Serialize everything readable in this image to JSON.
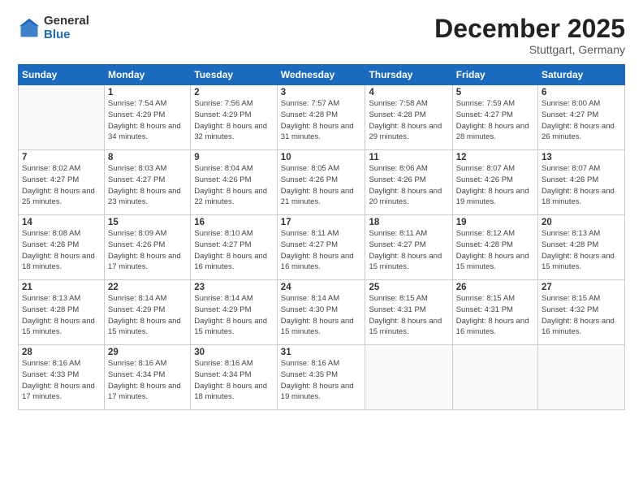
{
  "logo": {
    "general": "General",
    "blue": "Blue"
  },
  "header": {
    "month": "December 2025",
    "location": "Stuttgart, Germany"
  },
  "weekdays": [
    "Sunday",
    "Monday",
    "Tuesday",
    "Wednesday",
    "Thursday",
    "Friday",
    "Saturday"
  ],
  "weeks": [
    [
      {
        "day": "",
        "sunrise": "",
        "sunset": "",
        "daylight": ""
      },
      {
        "day": "1",
        "sunrise": "Sunrise: 7:54 AM",
        "sunset": "Sunset: 4:29 PM",
        "daylight": "Daylight: 8 hours and 34 minutes."
      },
      {
        "day": "2",
        "sunrise": "Sunrise: 7:56 AM",
        "sunset": "Sunset: 4:29 PM",
        "daylight": "Daylight: 8 hours and 32 minutes."
      },
      {
        "day": "3",
        "sunrise": "Sunrise: 7:57 AM",
        "sunset": "Sunset: 4:28 PM",
        "daylight": "Daylight: 8 hours and 31 minutes."
      },
      {
        "day": "4",
        "sunrise": "Sunrise: 7:58 AM",
        "sunset": "Sunset: 4:28 PM",
        "daylight": "Daylight: 8 hours and 29 minutes."
      },
      {
        "day": "5",
        "sunrise": "Sunrise: 7:59 AM",
        "sunset": "Sunset: 4:27 PM",
        "daylight": "Daylight: 8 hours and 28 minutes."
      },
      {
        "day": "6",
        "sunrise": "Sunrise: 8:00 AM",
        "sunset": "Sunset: 4:27 PM",
        "daylight": "Daylight: 8 hours and 26 minutes."
      }
    ],
    [
      {
        "day": "7",
        "sunrise": "Sunrise: 8:02 AM",
        "sunset": "Sunset: 4:27 PM",
        "daylight": "Daylight: 8 hours and 25 minutes."
      },
      {
        "day": "8",
        "sunrise": "Sunrise: 8:03 AM",
        "sunset": "Sunset: 4:27 PM",
        "daylight": "Daylight: 8 hours and 23 minutes."
      },
      {
        "day": "9",
        "sunrise": "Sunrise: 8:04 AM",
        "sunset": "Sunset: 4:26 PM",
        "daylight": "Daylight: 8 hours and 22 minutes."
      },
      {
        "day": "10",
        "sunrise": "Sunrise: 8:05 AM",
        "sunset": "Sunset: 4:26 PM",
        "daylight": "Daylight: 8 hours and 21 minutes."
      },
      {
        "day": "11",
        "sunrise": "Sunrise: 8:06 AM",
        "sunset": "Sunset: 4:26 PM",
        "daylight": "Daylight: 8 hours and 20 minutes."
      },
      {
        "day": "12",
        "sunrise": "Sunrise: 8:07 AM",
        "sunset": "Sunset: 4:26 PM",
        "daylight": "Daylight: 8 hours and 19 minutes."
      },
      {
        "day": "13",
        "sunrise": "Sunrise: 8:07 AM",
        "sunset": "Sunset: 4:26 PM",
        "daylight": "Daylight: 8 hours and 18 minutes."
      }
    ],
    [
      {
        "day": "14",
        "sunrise": "Sunrise: 8:08 AM",
        "sunset": "Sunset: 4:26 PM",
        "daylight": "Daylight: 8 hours and 18 minutes."
      },
      {
        "day": "15",
        "sunrise": "Sunrise: 8:09 AM",
        "sunset": "Sunset: 4:26 PM",
        "daylight": "Daylight: 8 hours and 17 minutes."
      },
      {
        "day": "16",
        "sunrise": "Sunrise: 8:10 AM",
        "sunset": "Sunset: 4:27 PM",
        "daylight": "Daylight: 8 hours and 16 minutes."
      },
      {
        "day": "17",
        "sunrise": "Sunrise: 8:11 AM",
        "sunset": "Sunset: 4:27 PM",
        "daylight": "Daylight: 8 hours and 16 minutes."
      },
      {
        "day": "18",
        "sunrise": "Sunrise: 8:11 AM",
        "sunset": "Sunset: 4:27 PM",
        "daylight": "Daylight: 8 hours and 15 minutes."
      },
      {
        "day": "19",
        "sunrise": "Sunrise: 8:12 AM",
        "sunset": "Sunset: 4:28 PM",
        "daylight": "Daylight: 8 hours and 15 minutes."
      },
      {
        "day": "20",
        "sunrise": "Sunrise: 8:13 AM",
        "sunset": "Sunset: 4:28 PM",
        "daylight": "Daylight: 8 hours and 15 minutes."
      }
    ],
    [
      {
        "day": "21",
        "sunrise": "Sunrise: 8:13 AM",
        "sunset": "Sunset: 4:28 PM",
        "daylight": "Daylight: 8 hours and 15 minutes."
      },
      {
        "day": "22",
        "sunrise": "Sunrise: 8:14 AM",
        "sunset": "Sunset: 4:29 PM",
        "daylight": "Daylight: 8 hours and 15 minutes."
      },
      {
        "day": "23",
        "sunrise": "Sunrise: 8:14 AM",
        "sunset": "Sunset: 4:29 PM",
        "daylight": "Daylight: 8 hours and 15 minutes."
      },
      {
        "day": "24",
        "sunrise": "Sunrise: 8:14 AM",
        "sunset": "Sunset: 4:30 PM",
        "daylight": "Daylight: 8 hours and 15 minutes."
      },
      {
        "day": "25",
        "sunrise": "Sunrise: 8:15 AM",
        "sunset": "Sunset: 4:31 PM",
        "daylight": "Daylight: 8 hours and 15 minutes."
      },
      {
        "day": "26",
        "sunrise": "Sunrise: 8:15 AM",
        "sunset": "Sunset: 4:31 PM",
        "daylight": "Daylight: 8 hours and 16 minutes."
      },
      {
        "day": "27",
        "sunrise": "Sunrise: 8:15 AM",
        "sunset": "Sunset: 4:32 PM",
        "daylight": "Daylight: 8 hours and 16 minutes."
      }
    ],
    [
      {
        "day": "28",
        "sunrise": "Sunrise: 8:16 AM",
        "sunset": "Sunset: 4:33 PM",
        "daylight": "Daylight: 8 hours and 17 minutes."
      },
      {
        "day": "29",
        "sunrise": "Sunrise: 8:16 AM",
        "sunset": "Sunset: 4:34 PM",
        "daylight": "Daylight: 8 hours and 17 minutes."
      },
      {
        "day": "30",
        "sunrise": "Sunrise: 8:16 AM",
        "sunset": "Sunset: 4:34 PM",
        "daylight": "Daylight: 8 hours and 18 minutes."
      },
      {
        "day": "31",
        "sunrise": "Sunrise: 8:16 AM",
        "sunset": "Sunset: 4:35 PM",
        "daylight": "Daylight: 8 hours and 19 minutes."
      },
      {
        "day": "",
        "sunrise": "",
        "sunset": "",
        "daylight": ""
      },
      {
        "day": "",
        "sunrise": "",
        "sunset": "",
        "daylight": ""
      },
      {
        "day": "",
        "sunrise": "",
        "sunset": "",
        "daylight": ""
      }
    ]
  ]
}
